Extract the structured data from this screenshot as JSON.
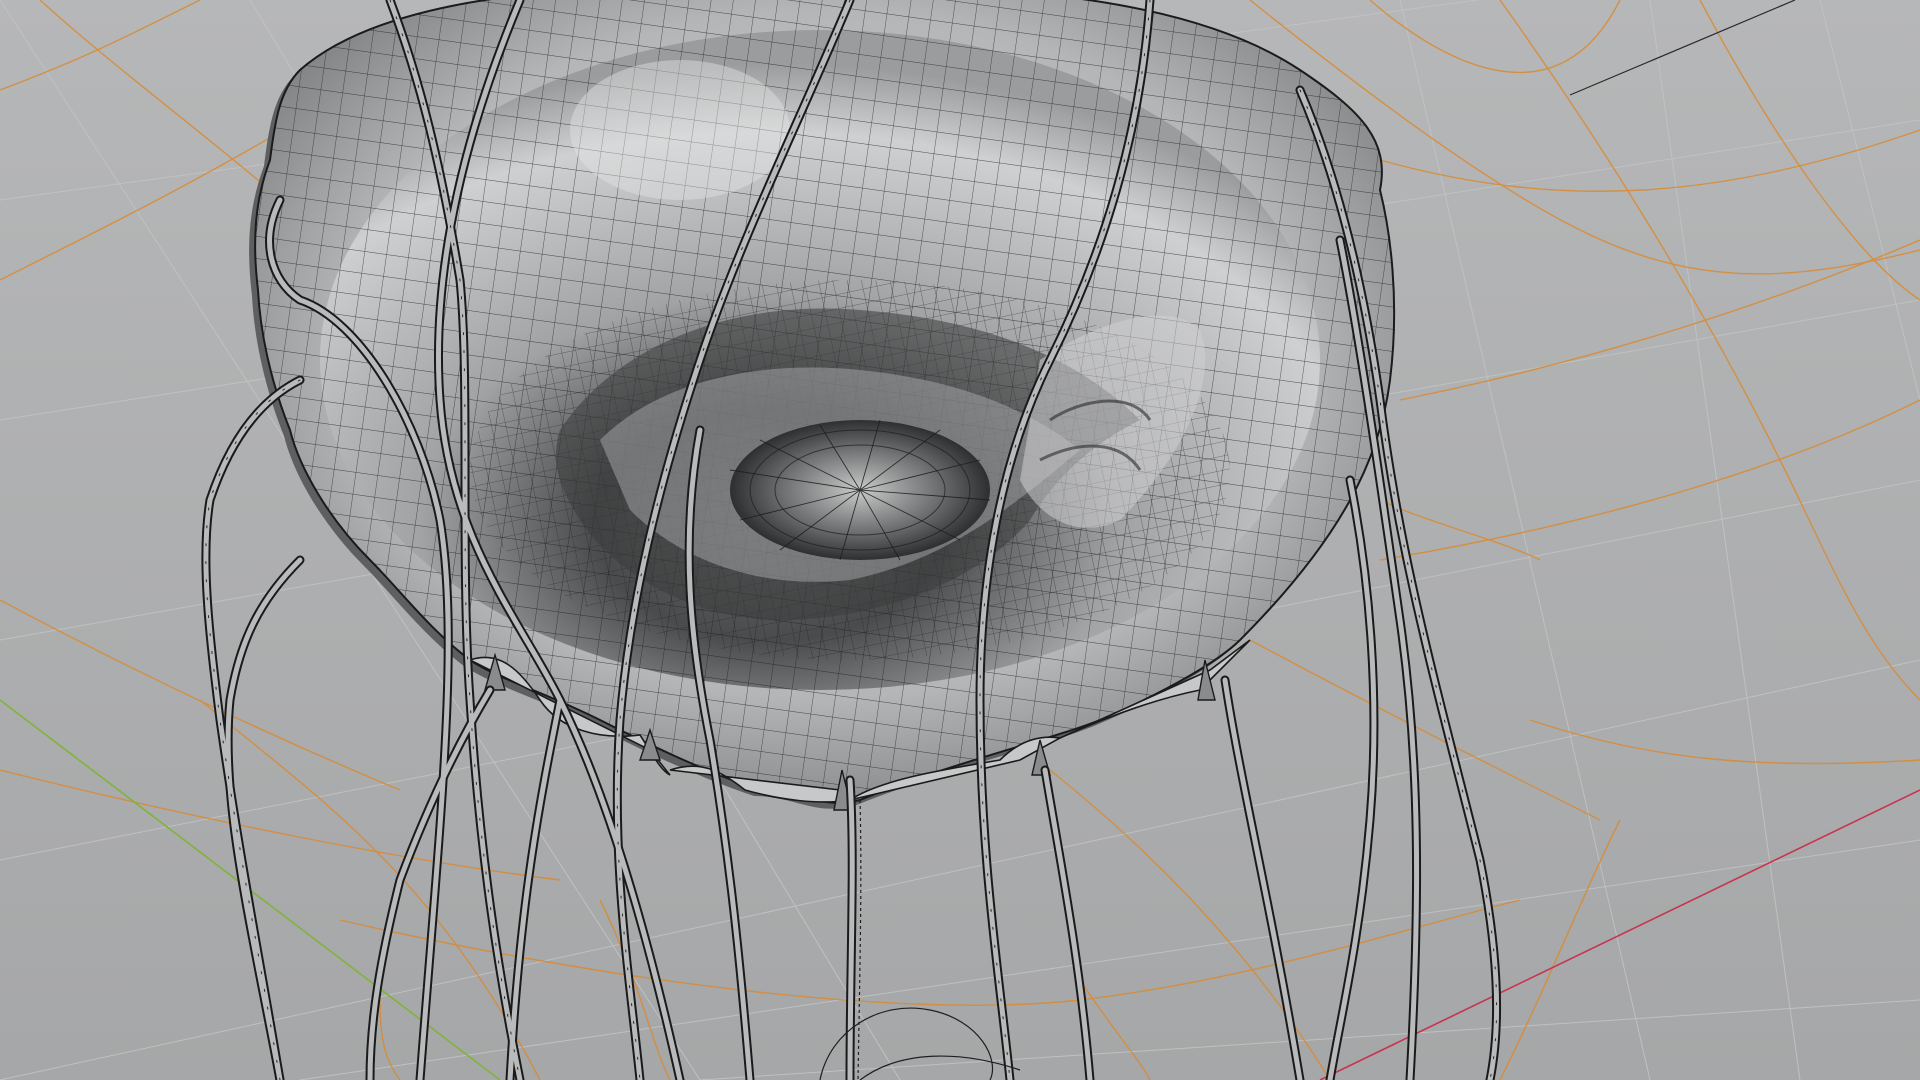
{
  "viewport": {
    "background_top": "#b3b4b5",
    "background_bottom": "#a7a8a9",
    "grid_color": "#d4852a",
    "x_axis_color": "#c8344f",
    "y_axis_color": "#7fb43a",
    "wire_color": "#1c1c1c",
    "mesh_shade_light": "#d7d8d9",
    "mesh_shade_dark": "#2a2a2a",
    "object": "jellyfish-mesh",
    "display_mode": "solid-with-wireframe-overlay"
  }
}
